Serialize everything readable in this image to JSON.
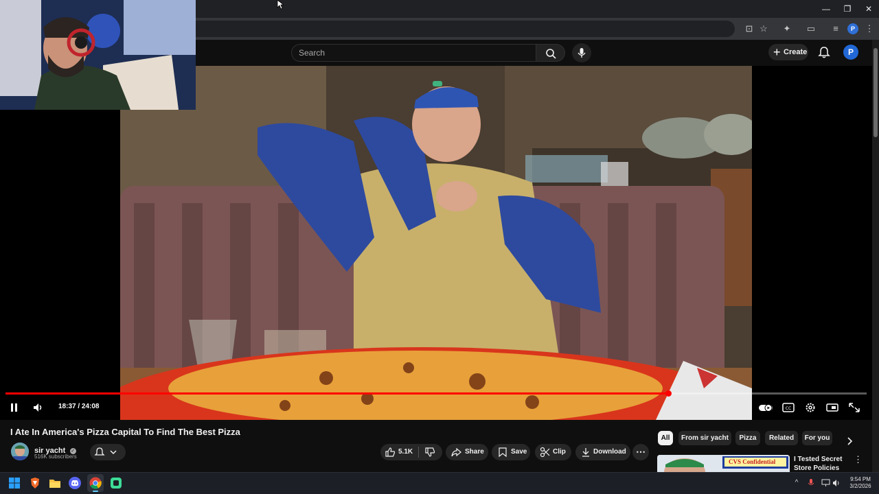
{
  "browser": {
    "window_controls": [
      "—",
      "❐",
      "✕"
    ]
  },
  "header": {
    "search_placeholder": "Search",
    "create_label": "Create",
    "avatar_letter": "P",
    "profile_letter": "P"
  },
  "player": {
    "time": "18:37 / 24:08",
    "progress_fraction": 0.77,
    "state": "playing"
  },
  "video": {
    "title": "I Ate In America's Pizza Capital To Find The Best Pizza"
  },
  "channel": {
    "name": "sir yacht",
    "verified_mark": "✓",
    "subscribers": "516K subscribers"
  },
  "actions": {
    "likes": "5.1K",
    "share": "Share",
    "save": "Save",
    "clip": "Clip",
    "download": "Download"
  },
  "chips": [
    "All",
    "From sir yacht",
    "Pizza",
    "Related",
    "For you"
  ],
  "recommendation": {
    "title_line1": "I Tested Secret",
    "title_line2": "Store Policies",
    "thumb_text": "CVS Confidential"
  },
  "taskbar": {
    "time": "9:54 PM",
    "date": "3/2/2026"
  },
  "colors": {
    "accent_red": "#ff0000",
    "background": "#0f0f0f",
    "chip_bg": "#272727"
  }
}
